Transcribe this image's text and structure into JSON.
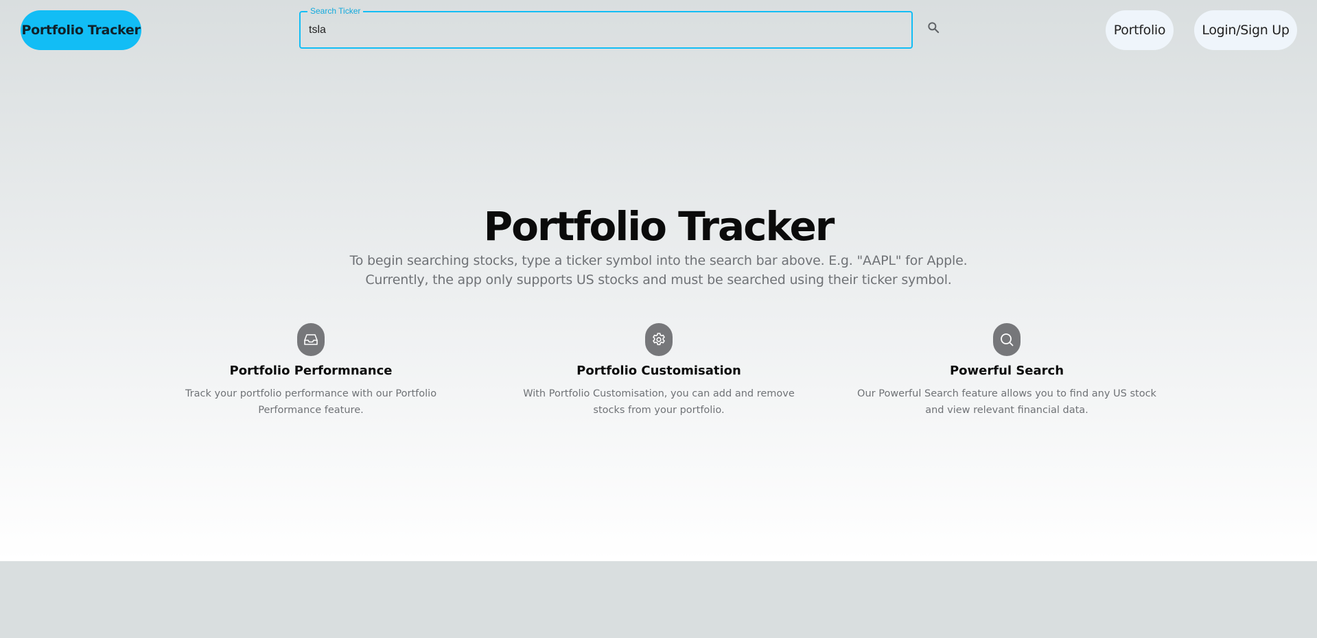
{
  "header": {
    "brand_label": "Portfolio Tracker",
    "search": {
      "label": "Search Ticker",
      "value": "tsla",
      "icon": "search-icon"
    },
    "nav": {
      "portfolio_label": "Portfolio",
      "login_label": "Login/Sign Up"
    }
  },
  "hero": {
    "title": "Portfolio Tracker",
    "line1": "To begin searching stocks, type a ticker symbol into the search bar above. E.g. \"AAPL\" for Apple.",
    "line2": "Currently, the app only supports US stocks and must be searched using their ticker symbol."
  },
  "features": [
    {
      "icon": "inbox-icon",
      "title": "Portfolio Performnance",
      "description": "Track your portfolio performance with our Portfolio Performance feature."
    },
    {
      "icon": "gear-icon",
      "title": "Portfolio Customisation",
      "description": "With Portfolio Customisation, you can add and remove stocks from your portfolio."
    },
    {
      "icon": "search-icon",
      "title": "Powerful Search",
      "description": "Our Powerful Search feature allows you to find any US stock and view relevant financial data."
    }
  ],
  "colors": {
    "accent": "#12bdf5",
    "background": "#d9dedf",
    "icon_badge": "#76777a",
    "nav_button": "#eff5fb"
  }
}
